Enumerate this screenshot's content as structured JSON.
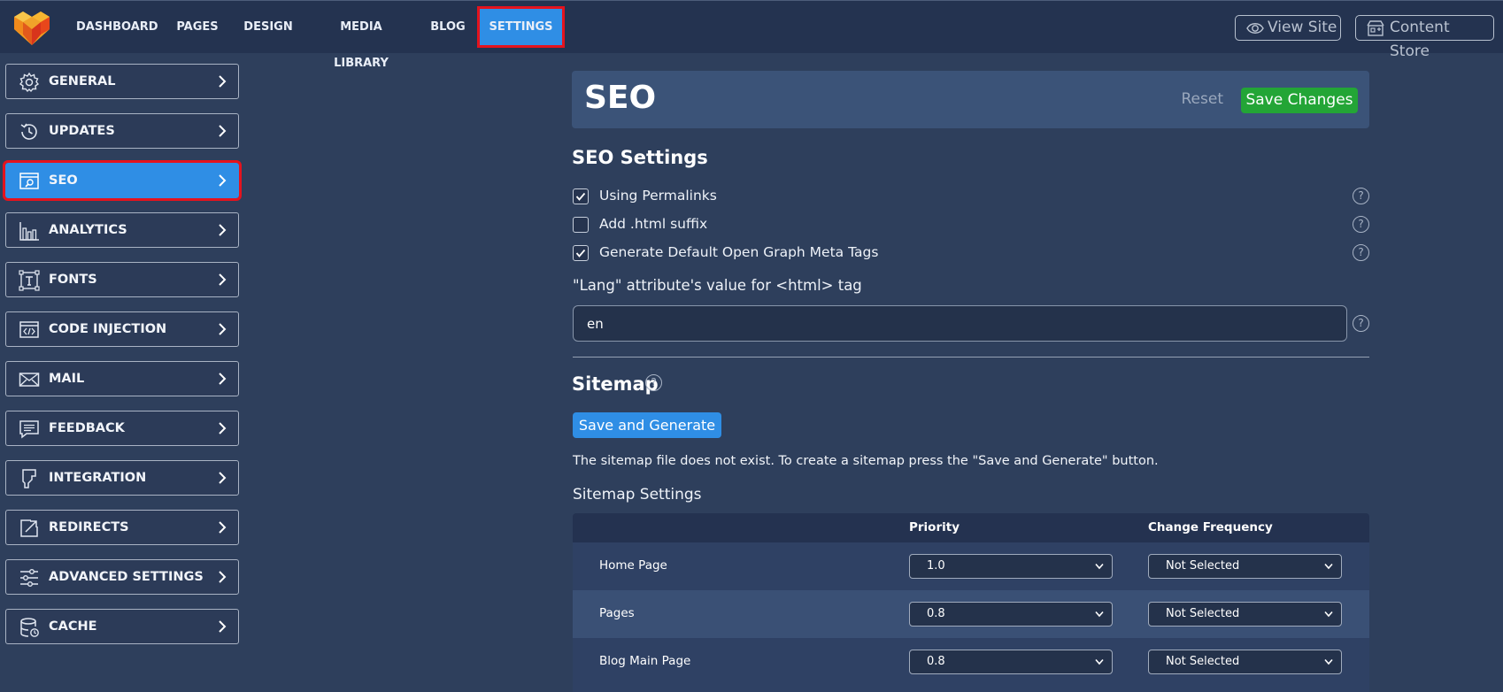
{
  "nav": {
    "items": [
      {
        "label": "DASHBOARD"
      },
      {
        "label": "PAGES"
      },
      {
        "label": "DESIGN"
      },
      {
        "label": "MEDIA LIBRARY"
      },
      {
        "label": "BLOG"
      },
      {
        "label": "SETTINGS"
      }
    ],
    "active": "SETTINGS",
    "view_site": "View Site",
    "content_store": "Content Store"
  },
  "sidebar": {
    "items": [
      {
        "label": "GENERAL",
        "icon": "gear-icon"
      },
      {
        "label": "UPDATES",
        "icon": "history-icon"
      },
      {
        "label": "SEO",
        "icon": "seo-search-icon"
      },
      {
        "label": "ANALYTICS",
        "icon": "bar-chart-icon"
      },
      {
        "label": "FONTS",
        "icon": "font-icon"
      },
      {
        "label": "CODE INJECTION",
        "icon": "code-icon"
      },
      {
        "label": "MAIL",
        "icon": "mail-icon"
      },
      {
        "label": "FEEDBACK",
        "icon": "feedback-icon"
      },
      {
        "label": "INTEGRATION",
        "icon": "integration-icon"
      },
      {
        "label": "REDIRECTS",
        "icon": "redirect-icon"
      },
      {
        "label": "ADVANCED SETTINGS",
        "icon": "sliders-icon"
      },
      {
        "label": "CACHE",
        "icon": "database-icon"
      }
    ],
    "active": "SEO"
  },
  "header": {
    "title": "SEO",
    "reset": "Reset",
    "save": "Save Changes"
  },
  "seo_settings": {
    "title": "SEO Settings",
    "options": [
      {
        "label": "Using Permalinks",
        "checked": true
      },
      {
        "label": "Add .html suffix",
        "checked": false
      },
      {
        "label": "Generate Default Open Graph Meta Tags",
        "checked": true
      }
    ],
    "lang_label": "\"Lang\" attribute's value for <html> tag",
    "lang_value": "en"
  },
  "sitemap": {
    "title": "Sitemap",
    "generate_button": "Save and Generate",
    "info": "The sitemap file does not exist. To create a sitemap press the \"Save and Generate\" button.",
    "settings_title": "Sitemap Settings",
    "columns": [
      "",
      "Priority",
      "Change Frequency"
    ],
    "rows": [
      {
        "name": "Home Page",
        "priority": "1.0",
        "frequency": "Not Selected"
      },
      {
        "name": "Pages",
        "priority": "0.8",
        "frequency": "Not Selected"
      },
      {
        "name": "Blog Main Page",
        "priority": "0.8",
        "frequency": "Not Selected"
      }
    ]
  },
  "colors": {
    "accent": "#2f8ee5",
    "success": "#23a536",
    "highlight": "#e5131d",
    "background": "#2e3f5c"
  }
}
